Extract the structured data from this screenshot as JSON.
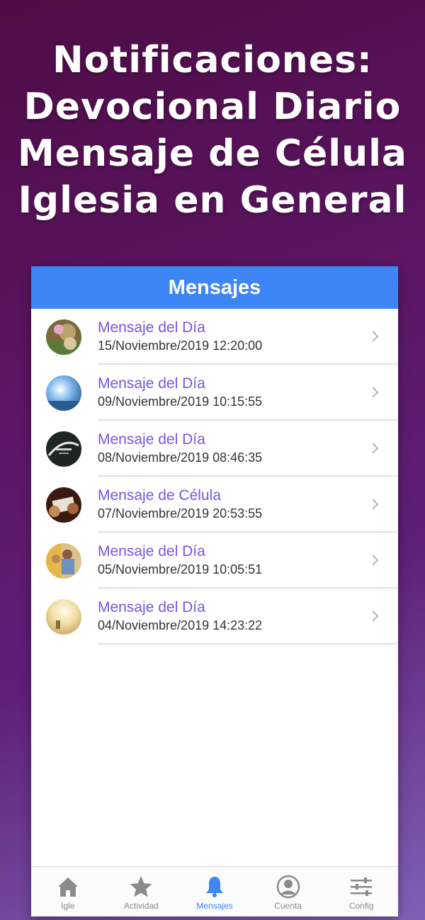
{
  "headline": {
    "lines": [
      "Notificaciones:",
      "Devocional Diario",
      "Mensaje de Célula",
      "Iglesia en General"
    ]
  },
  "navbar": {
    "title": "Mensajes"
  },
  "messages": [
    {
      "title": "Mensaje del Día",
      "date": "15/Noviembre/2019 12:20:00",
      "thumb": "flower-thumbnail"
    },
    {
      "title": "Mensaje del Día",
      "date": "09/Noviembre/2019 10:15:55",
      "thumb": "sky-thumbnail"
    },
    {
      "title": "Mensaje del Día",
      "date": "08/Noviembre/2019 08:46:35",
      "thumb": "dark-text-thumbnail"
    },
    {
      "title": "Mensaje de Célula",
      "date": "07/Noviembre/2019 20:53:55",
      "thumb": "hands-thumbnail"
    },
    {
      "title": "Mensaje del Día",
      "date": "05/Noviembre/2019 10:05:51",
      "thumb": "people-thumbnail"
    },
    {
      "title": "Mensaje del Día",
      "date": "04/Noviembre/2019 14:23:22",
      "thumb": "sunlight-thumbnail"
    }
  ],
  "tabbar": {
    "items": [
      {
        "label": "Igle",
        "icon": "home-icon"
      },
      {
        "label": "Actividad",
        "icon": "star-icon"
      },
      {
        "label": "Mensajes",
        "icon": "bell-icon",
        "active": true
      },
      {
        "label": "Cuenta",
        "icon": "user-icon"
      },
      {
        "label": "Config",
        "icon": "sliders-icon"
      }
    ]
  },
  "colors": {
    "accent": "#3e86f5",
    "title_purple": "#7a55e0"
  }
}
